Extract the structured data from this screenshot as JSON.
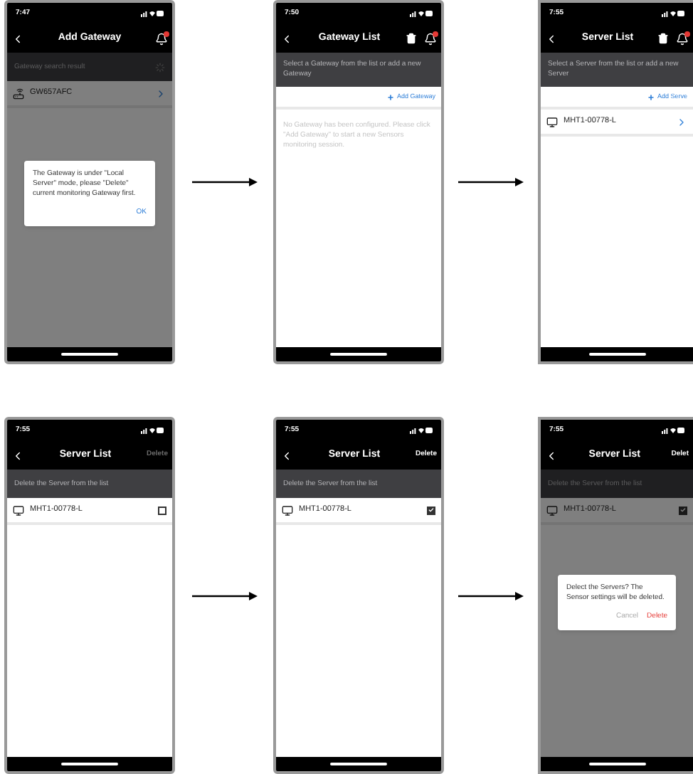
{
  "rows": [
    {
      "screens": [
        {
          "time": "7:47",
          "title": "Add Gateway",
          "header_right": [
            {
              "kind": "bell"
            }
          ],
          "banner": {
            "kind": "search",
            "text": "Gateway search result"
          },
          "items": [
            {
              "name": "GW657AFC",
              "kind": "gateway",
              "control": {
                "kind": "chevron"
              }
            }
          ],
          "dialog": {
            "message": "The Gateway is under \"Local Server\" mode, please \"Delete\" current monitoring Gateway first.",
            "buttons": [
              {
                "label": "OK",
                "kind": "primary"
              }
            ]
          }
        },
        {
          "time": "7:50",
          "title": "Gateway List",
          "header_right": [
            {
              "kind": "trash"
            },
            {
              "kind": "bell"
            }
          ],
          "banner": {
            "kind": "info",
            "text": "Select a Gateway from the list or add a new Gateway"
          },
          "add_link": "Add Gateway",
          "empty_message": "No Gateway has been configured. Please click \"Add Gateway\" to start a new Sensors monitoring session."
        },
        {
          "time": "7:55",
          "title": "Server List",
          "header_right": [
            {
              "kind": "trash"
            },
            {
              "kind": "bell"
            }
          ],
          "banner": {
            "kind": "info",
            "text": "Select a Server from the list or add a new Server"
          },
          "add_link": "Add Serve",
          "items": [
            {
              "name": "MHT1-00778-L",
              "kind": "server",
              "control": {
                "kind": "chevron"
              }
            }
          ]
        }
      ]
    },
    {
      "screens": [
        {
          "time": "7:55",
          "title": "Server List",
          "header_right": [
            {
              "kind": "text",
              "label": "Delete",
              "disabled": true
            }
          ],
          "banner": {
            "kind": "info",
            "text": "Delete the Server from the list"
          },
          "items": [
            {
              "name": "MHT1-00778-L",
              "kind": "server",
              "control": {
                "kind": "checkbox",
                "checked": false
              }
            }
          ]
        },
        {
          "time": "7:55",
          "title": "Server List",
          "header_right": [
            {
              "kind": "text",
              "label": "Delete",
              "disabled": false
            }
          ],
          "banner": {
            "kind": "info",
            "text": "Delete the Server from the list"
          },
          "items": [
            {
              "name": "MHT1-00778-L",
              "kind": "server",
              "control": {
                "kind": "checkbox",
                "checked": true
              }
            }
          ]
        },
        {
          "time": "7:55",
          "title": "Server List",
          "header_right": [
            {
              "kind": "text",
              "label": "Delet",
              "disabled": false
            }
          ],
          "banner": {
            "kind": "info",
            "text": "Delete the Server from the list"
          },
          "items": [
            {
              "name": "MHT1-00778-L",
              "kind": "server",
              "control": {
                "kind": "checkbox",
                "checked": true
              }
            }
          ],
          "dialog": {
            "message": "Delect the Servers? The Sensor settings will be deleted.",
            "buttons": [
              {
                "label": "Cancel",
                "kind": "cancel"
              },
              {
                "label": "Delete",
                "kind": "danger"
              }
            ]
          }
        }
      ]
    }
  ]
}
